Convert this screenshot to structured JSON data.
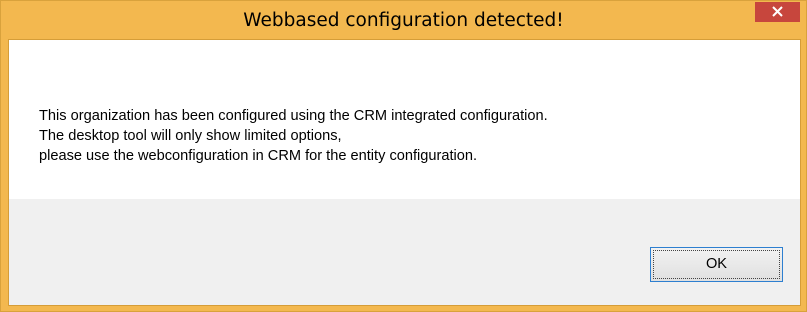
{
  "dialog": {
    "title": "Webbased configuration detected!",
    "close_icon": "close-icon",
    "message_lines": [
      "This organization has been configured using the CRM integrated configuration.",
      "The desktop tool will only show limited options,",
      "please use the webconfiguration in CRM for the entity configuration."
    ],
    "ok_label": "OK"
  },
  "colors": {
    "frame": "#f3b84f",
    "close_button": "#c7463d",
    "client_background": "#ffffff",
    "footer_background": "#f0f0f0",
    "button_border": "#2d7fd0"
  }
}
